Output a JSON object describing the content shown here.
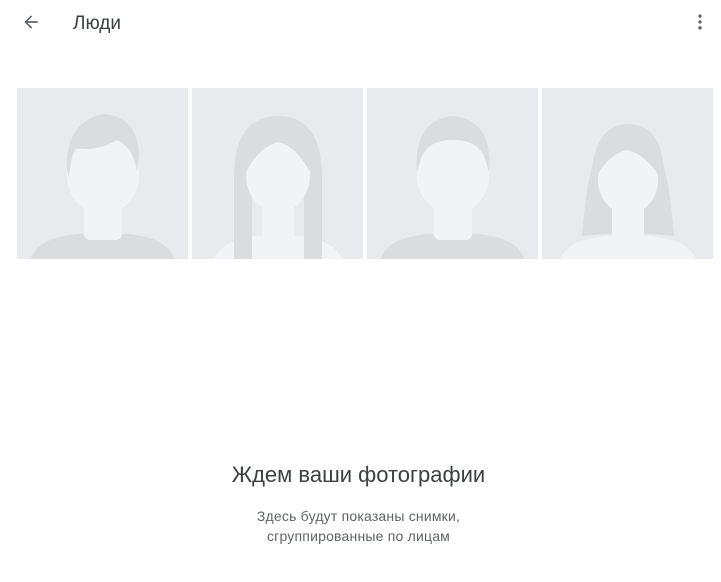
{
  "header": {
    "title": "Люди",
    "back_icon": "arrow-back-icon",
    "menu_icon": "more-vert-icon"
  },
  "placeholders": [
    {
      "figure": "male"
    },
    {
      "figure": "female-long-hair"
    },
    {
      "figure": "male"
    },
    {
      "figure": "female"
    }
  ],
  "empty_state": {
    "title": "Ждем ваши фотографии",
    "description_line1": "Здесь будут показаны снимки,",
    "description_line2": "сгруппированные по лицам"
  },
  "colors": {
    "tile_bg": "#e8eaed",
    "figure_face": "#f1f3f4",
    "figure_hair": "#dadce0",
    "text_primary": "#3c4043",
    "text_secondary": "#5f6368"
  }
}
